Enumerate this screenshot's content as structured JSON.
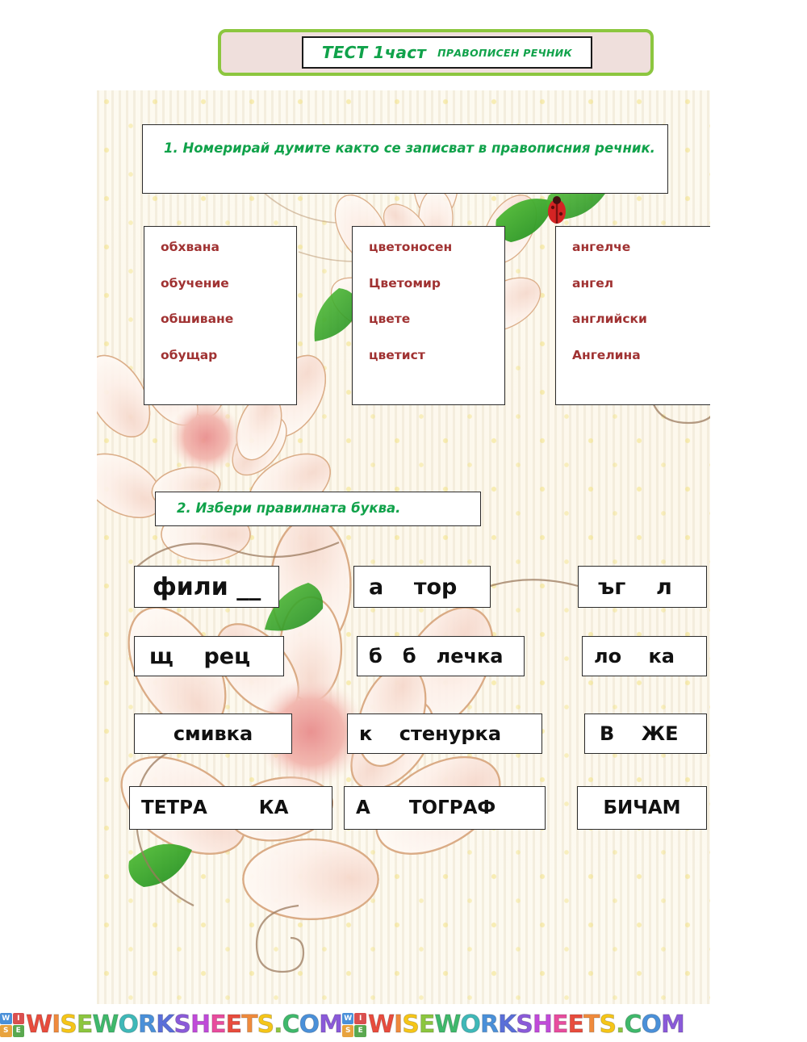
{
  "header": {
    "title_main": "ТЕСТ 1част",
    "title_sub": "ПРАВОПИСЕН РЕЧНИК",
    "frame_color": "#8cc63f",
    "fill_color": "#efdfdc",
    "text_color": "#10a24a"
  },
  "exercise1": {
    "instruction": "1. Номерирай  думите както се записват в правописния речник.",
    "instruction_number": "1.",
    "instruction_body": "Номерирай  думите както се записват в правописния речник.",
    "word_color": "#a03232",
    "columns": [
      {
        "words": [
          "обхвана",
          "обучение",
          "обшиване",
          "обущар"
        ]
      },
      {
        "words": [
          "цветоносен",
          "Цветомир",
          "цвете",
          "цветист"
        ]
      },
      {
        "words": [
          "ангелче",
          "ангел",
          "английски",
          "Ангелина"
        ]
      }
    ]
  },
  "exercise2": {
    "instruction": "2. Избери правилната буква.",
    "rows": [
      [
        {
          "text": "фили __",
          "size": 30,
          "align": "left",
          "pad": 22
        },
        {
          "text": "а    тор",
          "size": 27,
          "align": "left",
          "pad": 18
        },
        {
          "text": "ъг    л",
          "size": 27,
          "align": "left",
          "pad": 24
        }
      ],
      [
        {
          "text": "щ    рец",
          "size": 27,
          "align": "left",
          "pad": 18
        },
        {
          "text": "б   б   лечка",
          "size": 24,
          "align": "left",
          "pad": 14
        },
        {
          "text": "ло    ка",
          "size": 24,
          "align": "left",
          "pad": 14
        }
      ],
      [
        {
          "text": "смивка",
          "size": 24,
          "align": "center",
          "pad": 0
        },
        {
          "text": "к    стенурка",
          "size": 24,
          "align": "left",
          "pad": 14
        },
        {
          "text": "В    ЖЕ",
          "size": 24,
          "align": "left",
          "pad": 18
        }
      ],
      [
        {
          "text": "ТЕТРА        КА",
          "size": 23,
          "align": "left",
          "pad": 14
        },
        {
          "text": "А      ТОГРАФ",
          "size": 23,
          "align": "left",
          "pad": 14
        },
        {
          "text": "БИЧАМ",
          "size": 23,
          "align": "center",
          "pad": 0
        }
      ]
    ]
  },
  "footer": {
    "watermark_text": "WISEWORKSHEETS.COM",
    "badge_letters": [
      "W",
      "I",
      "S",
      "E"
    ],
    "badge_colors": [
      "#4a90d9",
      "#d94f4f",
      "#e8a33d",
      "#5aa84f"
    ],
    "letter_colors": [
      "#e84c3d",
      "#f08a3c",
      "#f5c518",
      "#8cc63f",
      "#3fb86b",
      "#3fb8b8",
      "#4a90d9",
      "#5a6fd9",
      "#8a5ad9",
      "#c04ad9",
      "#e84c9e",
      "#e84c3d",
      "#f08a3c",
      "#f5c518",
      "#8cc63f",
      "#3fb86b",
      "#4a90d9",
      "#8a5ad9"
    ]
  }
}
